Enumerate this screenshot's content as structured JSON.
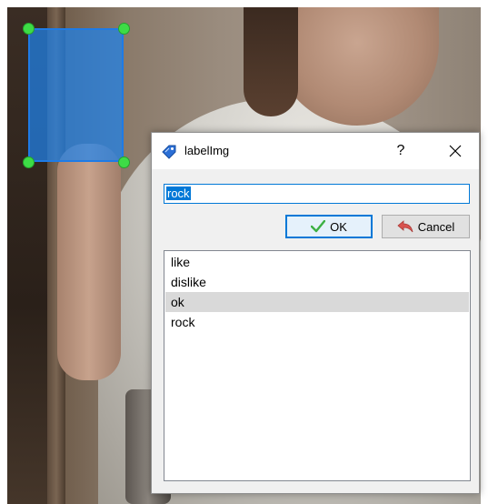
{
  "dialog": {
    "title": "labelImg",
    "help_label": "?",
    "input_value": "rock",
    "ok_label": "OK",
    "cancel_label": "Cancel",
    "labels": [
      "like",
      "dislike",
      "ok",
      "rock"
    ],
    "selected_label": "ok"
  },
  "colors": {
    "bbox_fill": "#1e82eb",
    "bbox_handle": "#3ddc46",
    "accent": "#0078d7"
  },
  "icons": {
    "app": "label-tag-icon",
    "close": "close-icon",
    "ok": "checkmark-icon",
    "cancel": "undo-arrow-icon"
  }
}
